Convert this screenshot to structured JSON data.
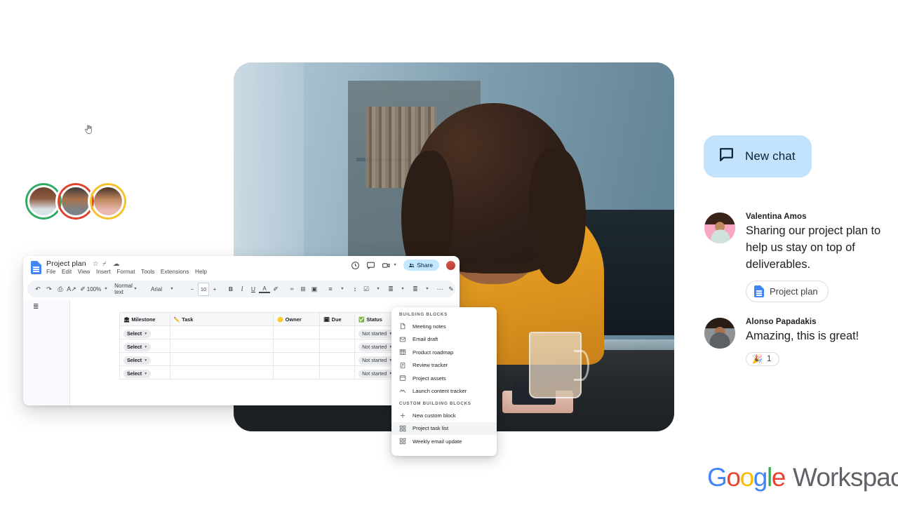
{
  "avatar_group": {
    "name": "collaborator-avatars",
    "avatars": [
      {
        "ring_color": "#2eaa63"
      },
      {
        "ring_color": "#e0402c"
      },
      {
        "ring_color": "#f4c228"
      }
    ]
  },
  "hero_photo": {
    "alt": "Woman with curly hair smiling while working on a laptop at a desk"
  },
  "docs": {
    "title": "Project plan",
    "title_icons": [
      "star-icon",
      "move-to-folder-icon",
      "cloud-saved-icon"
    ],
    "menu": [
      "File",
      "Edit",
      "View",
      "Insert",
      "Format",
      "Tools",
      "Extensions",
      "Help"
    ],
    "actions": {
      "history_icon": "version-history-icon",
      "comment_icon": "comment-icon",
      "meet_icon": "video-call-icon",
      "share_label": "Share",
      "share_bg": "#c2e7ff"
    },
    "toolbar": {
      "zoom": "100%",
      "style": "Normal text",
      "font": "Arial",
      "font_size": "10",
      "minus": "−",
      "plus": "+",
      "bold": "B",
      "italic": "I",
      "underline": "U",
      "text_color": "A",
      "highlight": "✎",
      "link": "∞",
      "comment": "⊞",
      "image": "☐",
      "align": "≡",
      "line_spacing": "↕",
      "checklist": "☰",
      "bulleted": "≡",
      "numbered": "≣",
      "more": "⋯",
      "pen": "✏",
      "collapse": "⌃"
    },
    "outline_icon": "document-outline-icon",
    "table": {
      "headers": [
        {
          "emoji": "🏛",
          "label": "Milestone"
        },
        {
          "emoji": "✏️",
          "label": "Task"
        },
        {
          "emoji": "🟡",
          "label": "Owner"
        },
        {
          "emoji": "🗓",
          "label": "Due"
        },
        {
          "emoji": "✅",
          "label": "Status"
        }
      ],
      "rows": [
        {
          "milestone": "Select",
          "task": "",
          "owner": "",
          "due": "",
          "status": "Not started"
        },
        {
          "milestone": "Select",
          "task": "",
          "owner": "",
          "due": "",
          "status": "Not started"
        },
        {
          "milestone": "Select",
          "task": "",
          "owner": "",
          "due": "",
          "status": "Not started"
        },
        {
          "milestone": "Select",
          "task": "",
          "owner": "",
          "due": "",
          "status": "Not started"
        }
      ]
    }
  },
  "building_blocks_menu": {
    "section_1_title": "BUILDING BLOCKS",
    "section_1_items": [
      {
        "icon": "meeting-notes-icon",
        "glyph": "὜b",
        "label": "Meeting notes"
      },
      {
        "icon": "email-draft-icon",
        "glyph": "✉",
        "label": "Email draft"
      },
      {
        "icon": "product-roadmap-icon",
        "glyph": "▤",
        "label": "Product roadmap"
      },
      {
        "icon": "review-tracker-icon",
        "glyph": "Ὕ2",
        "label": "Review tracker"
      },
      {
        "icon": "project-assets-icon",
        "glyph": "▦",
        "label": "Project assets"
      },
      {
        "icon": "launch-content-tracker-icon",
        "glyph": "〰",
        "label": "Launch content tracker"
      }
    ],
    "section_2_title": "CUSTOM BUILDING BLOCKS",
    "section_2_items": [
      {
        "icon": "plus-icon",
        "glyph": "＋",
        "label": "New custom block"
      },
      {
        "icon": "project-task-list-icon",
        "glyph": "▒",
        "label": "Project task list",
        "hovered": true
      },
      {
        "icon": "weekly-email-update-icon",
        "glyph": "▒",
        "label": "Weekly email update"
      }
    ]
  },
  "chat": {
    "new_chat_label": "New chat",
    "new_chat_icon": "chat-bubble-icon",
    "messages": [
      {
        "author": "Valentina Amos",
        "avatar_bg": "#f9a8c4",
        "text": "Sharing our project plan to help us stay on top of deliverables.",
        "attachment": {
          "label": "Project plan",
          "icon": "google-docs-icon"
        }
      },
      {
        "author": "Alonso Papadakis",
        "avatar_bg": "#8f9396",
        "text": "Amazing, this is great!",
        "reaction": {
          "emoji": "🎉",
          "count": "1"
        }
      }
    ]
  },
  "brand": {
    "google": [
      {
        "letter": "G",
        "color": "#4285F4"
      },
      {
        "letter": "o",
        "color": "#EA4335"
      },
      {
        "letter": "o",
        "color": "#FBBC05"
      },
      {
        "letter": "g",
        "color": "#4285F4"
      },
      {
        "letter": "l",
        "color": "#34A853"
      },
      {
        "letter": "e",
        "color": "#EA4335"
      }
    ],
    "product": "Workspace"
  }
}
